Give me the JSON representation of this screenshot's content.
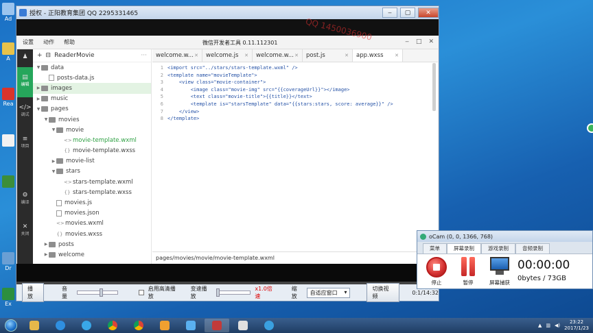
{
  "desktop": {
    "icons": [
      "Ad",
      "A",
      "Rea",
      "",
      "",
      "Dr",
      "Ex"
    ]
  },
  "player": {
    "title": "授权 - 正阳教育集团 QQ 2295331465",
    "watermark": "QQ 1450036900",
    "controls": {
      "play": "播放",
      "volume": "音量",
      "hq": "启用高清播放",
      "speed": "变速播放",
      "speed_value": "x1.0倍速",
      "zoom": "缩放",
      "zoom_option": "自适应窗口",
      "switch": "切换视频",
      "time": "0:1/14:32"
    }
  },
  "ide": {
    "menu": [
      "设置",
      "动作",
      "帮助"
    ],
    "title": "微信开发者工具 0.11.112301",
    "left_bar": [
      {
        "label": "编辑",
        "glyph": "▤"
      },
      {
        "label": "调试",
        "glyph": "</>"
      },
      {
        "label": "项目",
        "glyph": "≡"
      },
      {
        "label": "编译",
        "glyph": "⚙"
      },
      {
        "label": "关闭",
        "glyph": "✕"
      }
    ],
    "project": "ReaderMovie",
    "tree": [
      {
        "label": "data",
        "type": "folder",
        "indent": 0,
        "open": true
      },
      {
        "label": "posts-data.js",
        "type": "file",
        "indent": 1
      },
      {
        "label": "images",
        "type": "folder",
        "indent": 0,
        "open": false,
        "hl": true
      },
      {
        "label": "music",
        "type": "folder",
        "indent": 0,
        "open": false
      },
      {
        "label": "pages",
        "type": "folder",
        "indent": 0,
        "open": true
      },
      {
        "label": "movies",
        "type": "folder",
        "indent": 1,
        "open": true
      },
      {
        "label": "movie",
        "type": "folder",
        "indent": 2,
        "open": true
      },
      {
        "label": "movie-template.wxml",
        "type": "code",
        "indent": 3,
        "sel": true
      },
      {
        "label": "movie-template.wxss",
        "type": "code",
        "indent": 3
      },
      {
        "label": "movie-list",
        "type": "folder",
        "indent": 2,
        "open": false
      },
      {
        "label": "stars",
        "type": "folder",
        "indent": 2,
        "open": true
      },
      {
        "label": "stars-template.wxml",
        "type": "code",
        "indent": 3
      },
      {
        "label": "stars-template.wxss",
        "type": "code",
        "indent": 3
      },
      {
        "label": "movies.js",
        "type": "file",
        "indent": 2
      },
      {
        "label": "movies.json",
        "type": "file",
        "indent": 2
      },
      {
        "label": "movies.wxml",
        "type": "code",
        "indent": 2
      },
      {
        "label": "movies.wxss",
        "type": "code",
        "indent": 2
      },
      {
        "label": "posts",
        "type": "folder",
        "indent": 1,
        "open": false
      },
      {
        "label": "welcome",
        "type": "folder",
        "indent": 1,
        "open": false
      }
    ],
    "tabs": [
      {
        "label": "welcome.w...",
        "active": false
      },
      {
        "label": "welcome.js",
        "active": false
      },
      {
        "label": "welcome.w...",
        "active": false
      },
      {
        "label": "post.js",
        "active": false
      },
      {
        "label": "app.wxss",
        "active": true
      }
    ],
    "code": [
      "<import src=\"../stars/stars-template.wxml\" />",
      "<template name=\"movieTemplate\">",
      "    <view class=\"movie-container\">",
      "        <image class=\"movie-img\" src=\"{{coverageUrl}}\"></image>",
      "        <text class=\"movie-title\">{{title}}</text>",
      "        <template is=\"starsTemplate\" data=\"{{stars:stars, score: average}}\" />",
      "    </view>",
      "</template>"
    ],
    "status_path": "pages/movies/movie/movie-template.wxml"
  },
  "ocam": {
    "title": "oCam (0, 0, 1366, 768)",
    "tabs": [
      "菜单",
      "屏幕录制",
      "游戏录制",
      "音频录制"
    ],
    "active_tab": 1,
    "stop": "停止",
    "pause": "暂停",
    "capture": "屏幕捕获",
    "time": "00:00:00",
    "size": "0bytes / 73GB"
  },
  "taskbar": {
    "time": "23:22",
    "date": "2017/1/23",
    "apps": [
      "folder",
      "ie",
      "chat",
      "chrome",
      "chrome2",
      "app-k",
      "bird",
      "film",
      "ocam",
      "play"
    ]
  }
}
